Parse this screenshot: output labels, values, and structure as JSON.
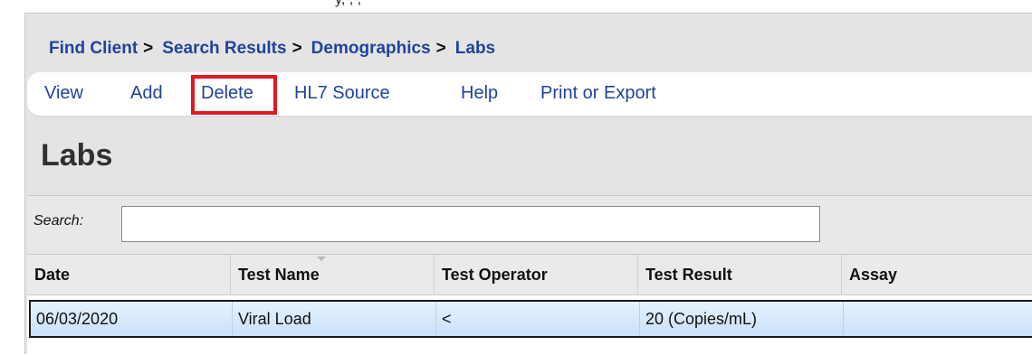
{
  "breadcrumb": [
    {
      "label": "Find Client",
      "sep": ">"
    },
    {
      "label": "Search Results",
      "sep": ">"
    },
    {
      "label": "Demographics",
      "sep": ">"
    },
    {
      "label": "Labs",
      "sep": ""
    }
  ],
  "toolbar": {
    "items": [
      {
        "label": "View"
      },
      {
        "label": "Add"
      },
      {
        "label": "Delete",
        "highlighted": true
      },
      {
        "label": "HL7 Source"
      },
      {
        "label": "Help"
      },
      {
        "label": "Print or Export"
      }
    ]
  },
  "page": {
    "title": "Labs"
  },
  "search": {
    "label": "Search:",
    "value": ""
  },
  "table": {
    "columns": [
      "Date",
      "Test Name",
      "Test Operator",
      "Test Result",
      "Assay"
    ],
    "rows": [
      [
        "06/03/2020",
        "Viral Load",
        "<",
        "20 (Copies/mL)",
        ""
      ]
    ]
  },
  "colors": {
    "link": "#20439b",
    "highlight_box": "#e01823",
    "selected_row": "#c8e1fa"
  }
}
